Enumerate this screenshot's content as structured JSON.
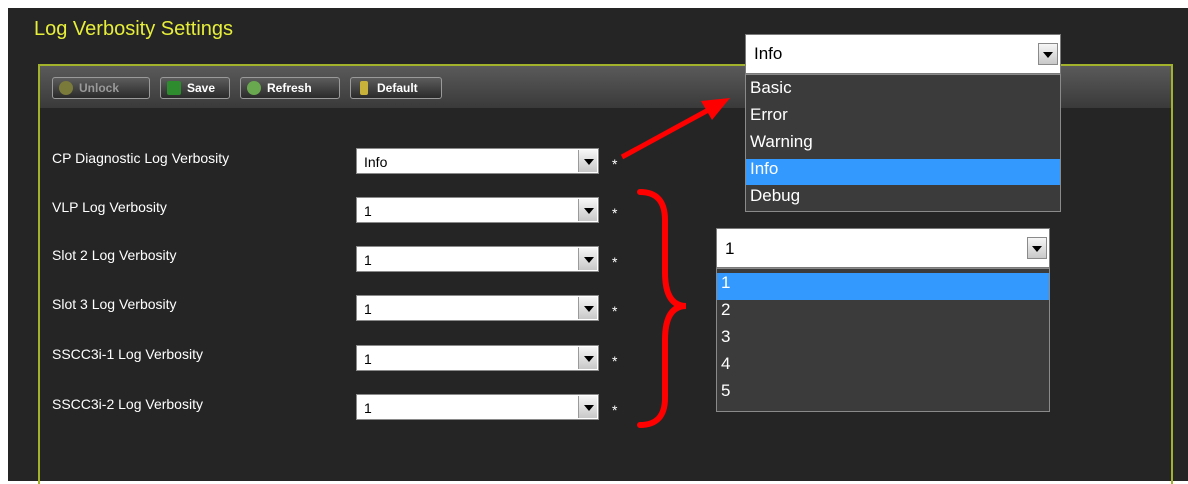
{
  "page": {
    "title": "Log Verbosity Settings"
  },
  "toolbar": {
    "unlock_label": "Unlock",
    "save_label": "Save",
    "refresh_label": "Refresh",
    "default_label": "Default"
  },
  "rows": [
    {
      "label": "CP Diagnostic Log Verbosity",
      "value": "Info",
      "required": "*"
    },
    {
      "label": "VLP Log Verbosity",
      "value": "1",
      "required": "*"
    },
    {
      "label": "Slot 2 Log Verbosity",
      "value": "1",
      "required": "*"
    },
    {
      "label": "Slot 3 Log Verbosity",
      "value": "1",
      "required": "*"
    },
    {
      "label": "SSCC3i-1 Log Verbosity",
      "value": "1",
      "required": "*"
    },
    {
      "label": "SSCC3i-2 Log Verbosity",
      "value": "1",
      "required": "*"
    }
  ],
  "dropdown_level": {
    "selected": "Info",
    "options": [
      "Basic",
      "Error",
      "Warning",
      "Info",
      "Debug"
    ]
  },
  "dropdown_number": {
    "selected": "1",
    "options": [
      "1",
      "2",
      "3",
      "4",
      "5"
    ]
  },
  "colors": {
    "title": "#e6ee3a",
    "panel_border": "#a2b22a",
    "background": "#252525",
    "highlight": "#3399ff",
    "annotation": "#ff0000"
  }
}
